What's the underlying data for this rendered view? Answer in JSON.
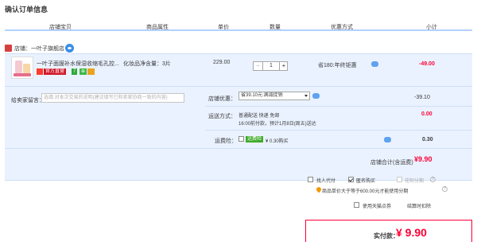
{
  "page": {
    "title": "确认订单信息"
  },
  "header": {
    "cols": [
      "店铺宝贝",
      "商品属性",
      "单价",
      "数量",
      "优惠方式",
      "小计"
    ]
  },
  "store": {
    "label": "店铺：一叶子旗舰店"
  },
  "item": {
    "name": "一叶子面膜补水保湿收缩毛孔控...",
    "attr": "化妆品净含量：3片",
    "price": "229.00",
    "qty": "1",
    "qty_minus": "−",
    "qty_plus": "+",
    "promo": "省180:年终钜惠",
    "subtotal": "-49.00",
    "badges": [
      "官方直营",
      "7",
      "⊕"
    ]
  },
  "message": {
    "label": "给卖家留言：",
    "placeholder": "选填:对本次交易的说明(建议填写已和卖家协商一致的内容)"
  },
  "coupon": {
    "label": "店铺优惠：",
    "selected": "省39.10元:满减促销",
    "value": "-39.10"
  },
  "shipping": {
    "label": "运送方式：",
    "line1": "普通配送 快递 免邮",
    "line2": "16:00前付款，预计1月8日(周五)送达",
    "value": "0.00"
  },
  "insurance": {
    "label": "运费险：",
    "badge": "运费险",
    "text": "¥ 0.30购买",
    "value": "0.30"
  },
  "store_total": {
    "label": "店铺合计(含运费)",
    "value": "¥9.90"
  },
  "options": {
    "pay_for_other": "找人代付",
    "anonymous": "匿名购买",
    "installment": "花呗分期",
    "tip": "商品单价大于等于600.00元才能使用分期",
    "tmall_points": "使用天猫点券",
    "settle_by_sub": "结算时扣除"
  },
  "pay": {
    "label": "实付款：",
    "amount": "¥ 9.90"
  },
  "colors": {
    "accent": "#ff0036",
    "row_bg": "#eaf2ff",
    "header_line": "#b2d1ff"
  }
}
